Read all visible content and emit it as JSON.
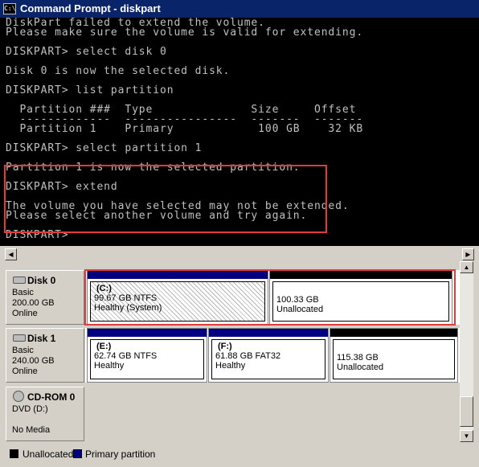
{
  "window": {
    "title": "Command Prompt - diskpart",
    "icon_text": "C:\\"
  },
  "console_lines": [
    "DiskPart failed to extend the volume.",
    "Please make sure the volume is valid for extending.",
    "",
    "DISKPART> select disk 0",
    "",
    "Disk 0 is now the selected disk.",
    "",
    "DISKPART> list partition",
    "",
    "  Partition ###  Type              Size     Offset",
    "  -------------  ----------------  -------  -------",
    "  Partition 1    Primary            100 GB    32 KB",
    "",
    "DISKPART> select partition 1",
    "",
    "Partition 1 is now the selected partition.",
    "",
    "DISKPART> extend",
    "",
    "The volume you have selected may not be extended.",
    "Please select another volume and try again.",
    "",
    "DISKPART>"
  ],
  "disks": [
    {
      "name": "Disk 0",
      "type": "Basic",
      "size": "200.00 GB",
      "status": "Online",
      "partitions": [
        {
          "letter": "(C:)",
          "size_fs": "99.67 GB NTFS",
          "status": "Healthy (System)"
        },
        {
          "letter": "",
          "size_fs": "100.33 GB",
          "status": "Unallocated"
        }
      ]
    },
    {
      "name": "Disk 1",
      "type": "Basic",
      "size": "240.00 GB",
      "status": "Online",
      "partitions": [
        {
          "letter": "(E:)",
          "size_fs": "62.74 GB NTFS",
          "status": "Healthy"
        },
        {
          "letter": "(F:)",
          "size_fs": "61.88 GB FAT32",
          "status": "Healthy"
        },
        {
          "letter": "",
          "size_fs": "115.38 GB",
          "status": "Unallocated"
        }
      ]
    },
    {
      "name": "CD-ROM 0",
      "type": "DVD (D:)",
      "size": "",
      "status": "No Media",
      "partitions": []
    }
  ],
  "legend": {
    "unallocated": {
      "label": "Unallocated",
      "color": "#000000"
    },
    "primary": {
      "label": "Primary partition",
      "color": "#000080"
    }
  },
  "colors": {
    "highlight": "#e23b3b",
    "console_bg": "#000000",
    "console_fg": "#c0c0c0",
    "titlebar": "#0a246a"
  }
}
